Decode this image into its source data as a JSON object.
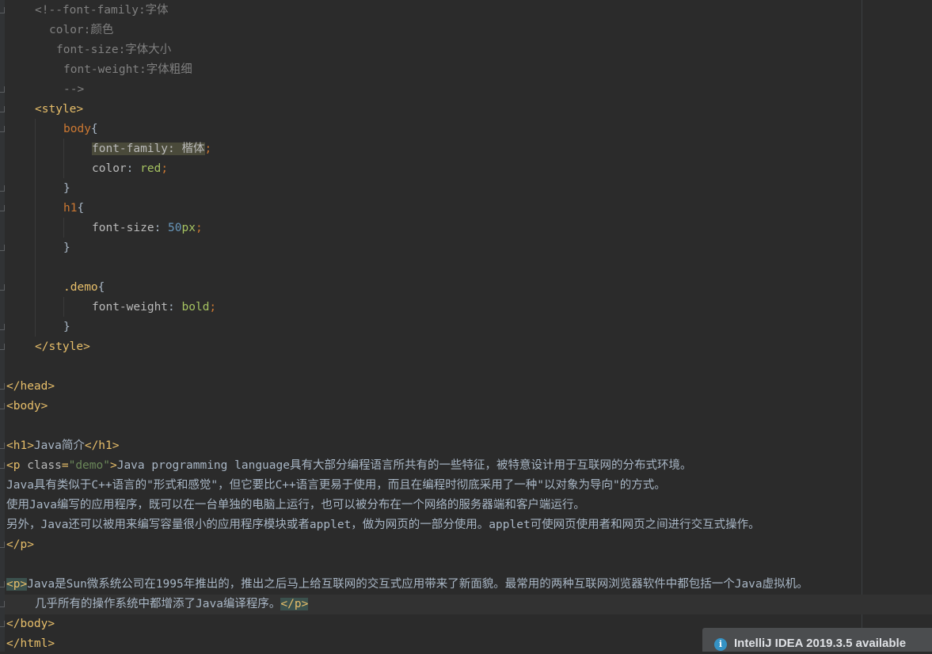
{
  "editor": {
    "lines": [
      {
        "indent": 4,
        "segments": [
          {
            "text": "<!--font-family:字体",
            "cls": "c-comment"
          }
        ]
      },
      {
        "indent": 6,
        "segments": [
          {
            "text": "color:颜色",
            "cls": "c-comment"
          }
        ]
      },
      {
        "indent": 7,
        "segments": [
          {
            "text": "font-size:字体大小",
            "cls": "c-comment"
          }
        ]
      },
      {
        "indent": 8,
        "segments": [
          {
            "text": "font-weight:字体粗细",
            "cls": "c-comment"
          }
        ]
      },
      {
        "indent": 8,
        "segments": [
          {
            "text": "-->",
            "cls": "c-comment"
          }
        ]
      },
      {
        "indent": 4,
        "segments": [
          {
            "text": "<style>",
            "cls": "c-tag"
          }
        ]
      },
      {
        "indent": 8,
        "segments": [
          {
            "text": "body",
            "cls": "c-sel"
          },
          {
            "text": "{",
            "cls": "c-punc"
          }
        ]
      },
      {
        "indent": 12,
        "segments": [
          {
            "text": "font-family: 楷体",
            "cls": "c-prop hl-prop"
          },
          {
            "text": ";",
            "cls": "c-sel"
          }
        ]
      },
      {
        "indent": 12,
        "segments": [
          {
            "text": "color",
            "cls": "c-prop"
          },
          {
            "text": ": ",
            "cls": "c-punc"
          },
          {
            "text": "red",
            "cls": "c-val"
          },
          {
            "text": ";",
            "cls": "c-sel"
          }
        ]
      },
      {
        "indent": 8,
        "segments": [
          {
            "text": "}",
            "cls": "c-punc"
          }
        ]
      },
      {
        "indent": 8,
        "segments": [
          {
            "text": "h1",
            "cls": "c-sel"
          },
          {
            "text": "{",
            "cls": "c-punc"
          }
        ]
      },
      {
        "indent": 12,
        "segments": [
          {
            "text": "font-size",
            "cls": "c-prop"
          },
          {
            "text": ": ",
            "cls": "c-punc"
          },
          {
            "text": "50",
            "cls": "c-num"
          },
          {
            "text": "px",
            "cls": "c-unit"
          },
          {
            "text": ";",
            "cls": "c-sel"
          }
        ]
      },
      {
        "indent": 8,
        "segments": [
          {
            "text": "}",
            "cls": "c-punc"
          }
        ]
      },
      {
        "indent": 0,
        "segments": []
      },
      {
        "indent": 8,
        "segments": [
          {
            "text": ".demo",
            "cls": "c-cls"
          },
          {
            "text": "{",
            "cls": "c-punc"
          }
        ]
      },
      {
        "indent": 12,
        "segments": [
          {
            "text": "font-weight",
            "cls": "c-prop"
          },
          {
            "text": ": ",
            "cls": "c-punc"
          },
          {
            "text": "bold",
            "cls": "c-val"
          },
          {
            "text": ";",
            "cls": "c-sel"
          }
        ]
      },
      {
        "indent": 8,
        "segments": [
          {
            "text": "}",
            "cls": "c-punc"
          }
        ]
      },
      {
        "indent": 4,
        "segments": [
          {
            "text": "</style>",
            "cls": "c-tag"
          }
        ]
      },
      {
        "indent": 0,
        "segments": []
      },
      {
        "indent": 0,
        "segments": [
          {
            "text": "</head>",
            "cls": "c-tag"
          }
        ]
      },
      {
        "indent": 0,
        "segments": [
          {
            "text": "<body>",
            "cls": "c-tag"
          }
        ]
      },
      {
        "indent": 0,
        "segments": []
      },
      {
        "indent": 0,
        "segments": [
          {
            "text": "<h1>",
            "cls": "c-tag"
          },
          {
            "text": "Java简介",
            "cls": "c-text"
          },
          {
            "text": "</h1>",
            "cls": "c-tag"
          }
        ]
      },
      {
        "indent": 0,
        "segments": [
          {
            "text": "<p ",
            "cls": "c-tag"
          },
          {
            "text": "class",
            "cls": "c-attr"
          },
          {
            "text": "=",
            "cls": "c-tag"
          },
          {
            "text": "\"demo\"",
            "cls": "c-str"
          },
          {
            "text": ">",
            "cls": "c-tag"
          },
          {
            "text": "Java programming language具有大部分编程语言所共有的一些特征，被特意设计用于互联网的分布式环境。",
            "cls": "c-text"
          }
        ]
      },
      {
        "indent": 0,
        "segments": [
          {
            "text": "Java具有类似于C++语言的\"形式和感觉\"，但它要比C++语言更易于使用，而且在编程时彻底采用了一种\"以对象为导向\"的方式。",
            "cls": "c-text"
          }
        ]
      },
      {
        "indent": 0,
        "segments": [
          {
            "text": "使用Java编写的应用程序，既可以在一台单独的电脑上运行，也可以被分布在一个网络的服务器端和客户端运行。",
            "cls": "c-text"
          }
        ]
      },
      {
        "indent": 0,
        "segments": [
          {
            "text": "另外，Java还可以被用来编写容量很小的应用程序模块或者applet，做为网页的一部分使用。applet可使网页使用者和网页之间进行交互式操作。",
            "cls": "c-text"
          }
        ]
      },
      {
        "indent": 0,
        "segments": [
          {
            "text": "</p>",
            "cls": "c-tag"
          }
        ]
      },
      {
        "indent": 0,
        "segments": []
      },
      {
        "indent": 0,
        "segments": [
          {
            "text": "<p>",
            "cls": "c-tag tag-match"
          },
          {
            "text": "Java是Sun微系统公司在1995年推出的，推出之后马上给互联网的交互式应用带来了新面貌。最常用的两种互联网浏览器软件中都包括一个Java虚拟机。",
            "cls": "c-text"
          }
        ]
      },
      {
        "indent": 4,
        "segments": [
          {
            "text": "几乎所有的操作系统中都增添了Java编译程序。",
            "cls": "c-text"
          },
          {
            "text": "</p>",
            "cls": "c-tag tag-match"
          }
        ]
      },
      {
        "indent": 0,
        "segments": [
          {
            "text": "</body>",
            "cls": "c-tag"
          }
        ]
      },
      {
        "indent": 0,
        "segments": [
          {
            "text": "</html>",
            "cls": "c-tag"
          }
        ]
      }
    ]
  },
  "notification": {
    "icon": "info-icon",
    "text": "IntelliJ IDEA 2019.3.5 available"
  }
}
